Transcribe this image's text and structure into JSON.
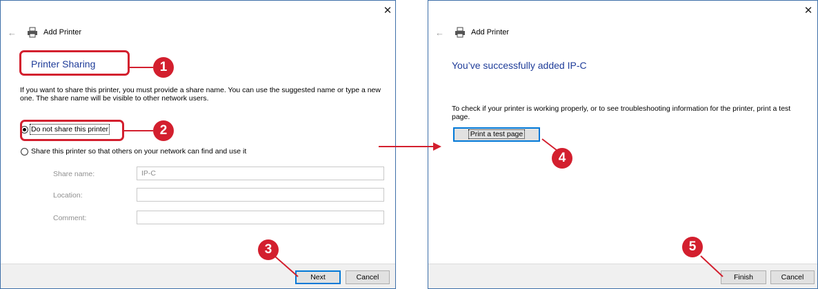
{
  "dialog1": {
    "close_icon": "✕",
    "back_icon": "←",
    "title": "Add Printer",
    "heading": "Printer Sharing",
    "description": "If you want to share this printer, you must provide a share name. You can use the suggested name or type a new one. The share name will be visible to other network users.",
    "option_no_share": "Do not share this printer",
    "option_share": "Share this printer so that others on your network can find and use it",
    "share_name_label": "Share name:",
    "share_name_value": "IP-C",
    "location_label": "Location:",
    "location_value": "",
    "comment_label": "Comment:",
    "comment_value": "",
    "next_label": "Next",
    "cancel_label": "Cancel"
  },
  "dialog2": {
    "close_icon": "✕",
    "back_icon": "←",
    "title": "Add Printer",
    "heading": "You’ve successfully added IP-C",
    "description": "To check if your printer is working properly, or to see troubleshooting information for the printer, print a test page.",
    "test_page_label": "Print a test page",
    "finish_label": "Finish",
    "cancel_label": "Cancel"
  },
  "callouts": [
    "1",
    "2",
    "3",
    "4",
    "5"
  ],
  "colors": {
    "callout": "#d31f2e",
    "heading": "#1e3c99",
    "focus": "#0078d7"
  }
}
